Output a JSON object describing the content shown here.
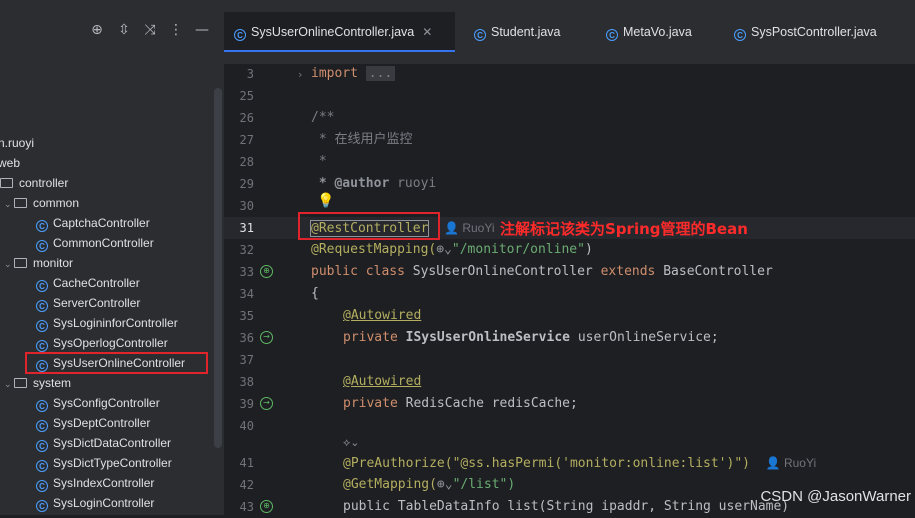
{
  "toolbar": {
    "icons": [
      "target-icon",
      "expand-collapse-icon",
      "collapse-all-icon",
      "more-options-icon",
      "minimize-icon"
    ]
  },
  "tree": {
    "rows": [
      {
        "label": "n.ruoyi",
        "depth": 0,
        "kind": "package"
      },
      {
        "label": "web",
        "depth": 0,
        "kind": "package"
      },
      {
        "label": "controller",
        "depth": 1,
        "kind": "folder"
      },
      {
        "label": "common",
        "depth": 2,
        "kind": "folder"
      },
      {
        "label": "CaptchaController",
        "depth": 3,
        "kind": "class"
      },
      {
        "label": "CommonController",
        "depth": 3,
        "kind": "class"
      },
      {
        "label": "monitor",
        "depth": 2,
        "kind": "folder"
      },
      {
        "label": "CacheController",
        "depth": 3,
        "kind": "class"
      },
      {
        "label": "ServerController",
        "depth": 3,
        "kind": "class"
      },
      {
        "label": "SysLogininforController",
        "depth": 3,
        "kind": "class"
      },
      {
        "label": "SysOperlogController",
        "depth": 3,
        "kind": "class"
      },
      {
        "label": "SysUserOnlineController",
        "depth": 3,
        "kind": "class"
      },
      {
        "label": "system",
        "depth": 2,
        "kind": "folder"
      },
      {
        "label": "SysConfigController",
        "depth": 3,
        "kind": "class"
      },
      {
        "label": "SysDeptController",
        "depth": 3,
        "kind": "class"
      },
      {
        "label": "SysDictDataController",
        "depth": 3,
        "kind": "class"
      },
      {
        "label": "SysDictTypeController",
        "depth": 3,
        "kind": "class"
      },
      {
        "label": "SysIndexController",
        "depth": 3,
        "kind": "class"
      },
      {
        "label": "SysLoginController",
        "depth": 3,
        "kind": "class"
      }
    ]
  },
  "tabs": [
    {
      "label": "SysUserOnlineController.java",
      "active": true
    },
    {
      "label": "Student.java",
      "active": false
    },
    {
      "label": "MetaVo.java",
      "active": false
    },
    {
      "label": "SysPostController.java",
      "active": false
    }
  ],
  "editor": {
    "line_numbers": [
      "3",
      "25",
      "26",
      "27",
      "28",
      "29",
      "30",
      "31",
      "32",
      "33",
      "34",
      "35",
      "36",
      "37",
      "38",
      "39",
      "40",
      "",
      "41",
      "42",
      "43"
    ],
    "current_line": "31",
    "import_line": "import",
    "import_fold": "...",
    "doc_open": "/**",
    "doc_desc": " * 在线用户监控",
    "doc_star": " *",
    "doc_author_tag": " * @author",
    "doc_author_name": " ruoyi",
    "rest_controller": "@RestController",
    "author_inlay": "RuoYi",
    "request_mapping": "@RequestMapping(",
    "request_mapping_value": "\"/monitor/online\"",
    "class_decl_kw": "public class ",
    "class_decl_name": "SysUserOnlineController ",
    "class_decl_extends": "extends ",
    "class_decl_base": "BaseController",
    "open_brace": "{",
    "autowired": "@Autowired",
    "field1_kw": "private ",
    "field1_type": "ISysUserOnlineService ",
    "field1_name": "userOnlineService;",
    "field2_kw": "private ",
    "field2_type": "RedisCache ",
    "field2_name": "redisCache;",
    "preauthorize": "@PreAuthorize(\"@ss.hasPermi('monitor:online:list')\")",
    "preauthorize_inlay": "RuoYi",
    "getmapping": "@GetMapping(",
    "getmapping_value": "\"/list\")",
    "method_decl": "public TableDataInfo list(String ipaddr, String userName)"
  },
  "annotation_note": "注解标记该类为Spring管理的Bean",
  "watermark": "CSDN @JasonWarner"
}
